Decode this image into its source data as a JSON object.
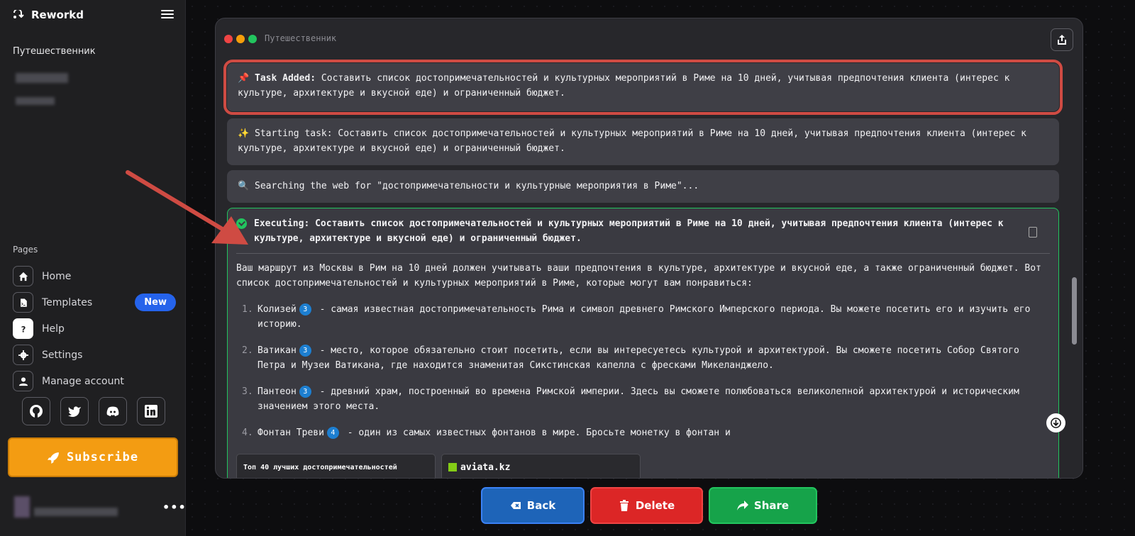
{
  "app": {
    "brand": "Reworkd"
  },
  "sidebar": {
    "agent_name": "Путешественник",
    "pages_title": "Pages",
    "nav": [
      {
        "label": "Home",
        "icon": "home-icon"
      },
      {
        "label": "Templates",
        "icon": "templates-icon",
        "badge": "New"
      },
      {
        "label": "Help",
        "icon": "help-icon"
      },
      {
        "label": "Settings",
        "icon": "gear-icon"
      },
      {
        "label": "Manage account",
        "icon": "user-icon"
      }
    ],
    "socials": [
      "github-icon",
      "twitter-icon",
      "discord-icon",
      "linkedin-icon"
    ],
    "subscribe_label": "Subscribe",
    "user_menu": "•••"
  },
  "window": {
    "title": "Путешественник",
    "dot_colors": [
      "#ef4444",
      "#f59e0b",
      "#22c55e"
    ],
    "cards": {
      "task_added_prefix": "Task Added:",
      "task_added_text": " Составить список достопримечательностей и культурных мероприятий в Риме на 10 дней, учитывая предпочтения клиента (интерес к культуре, архитектуре и вкусной еде) и ограниченный бюджет.",
      "starting_text": "✨ Starting task: Составить список достопримечательностей и культурных мероприятий в Риме на 10 дней, учитывая предпочтения клиента (интерес к культуре, архитектуре и вкусной еде) и ограниченный бюджет.",
      "searching_text": "Searching the web for \"достопримечательности и культурные мероприятия в Риме\"...",
      "executing_title": "Executing: Составить список достопримечательностей и культурных мероприятий в Риме на 10 дней, учитывая предпочтения клиента (интерес к культуре, архитектуре и вкусной еде) и ограниченный бюджет.",
      "intro": "Ваш маршрут из Москвы в Рим на 10 дней должен учитывать ваши предпочтения в культуре, архитектуре и вкусной еде, а также ограниченный бюджет. Вот список достопримечательностей и культурных мероприятий в Риме, которые могут вам понравиться:",
      "items": [
        {
          "num": "1.",
          "name": "Колизей",
          "cite": "3",
          "text": " - самая известная достопримечательность Рима и символ древнего Римского Имперского периода. Вы можете посетить его и изучить его историю."
        },
        {
          "num": "2.",
          "name": "Ватикан",
          "cite": "3",
          "text": " - место, которое обязательно стоит посетить, если вы интересуетесь культурой и архитектурой. Вы сможете посетить Собор Святого Петра и Музеи Ватикана, где находится знаменитая Сикстинская капелла с фресками Микеланджело."
        },
        {
          "num": "3.",
          "name": "Пантеон",
          "cite": "3",
          "text": " - древний храм, построенный во времена Римской империи. Здесь вы сможете полюбоваться великолепной архитектурой и историческим значением этого места."
        },
        {
          "num": "4.",
          "name": "Фонтан Треви",
          "cite": "4",
          "text": " - один из самых известных фонтанов в мире. Бросьте монетку в фонтан и"
        }
      ],
      "sources": [
        "Топ 40 лучших достопримечательностей",
        "aviata.kz"
      ]
    }
  },
  "buttons": {
    "back": "Back",
    "delete": "Delete",
    "share": "Share"
  },
  "colors": {
    "accent_orange": "#f39c12",
    "annotation_red": "#cf4b43",
    "success": "#22c55e"
  }
}
